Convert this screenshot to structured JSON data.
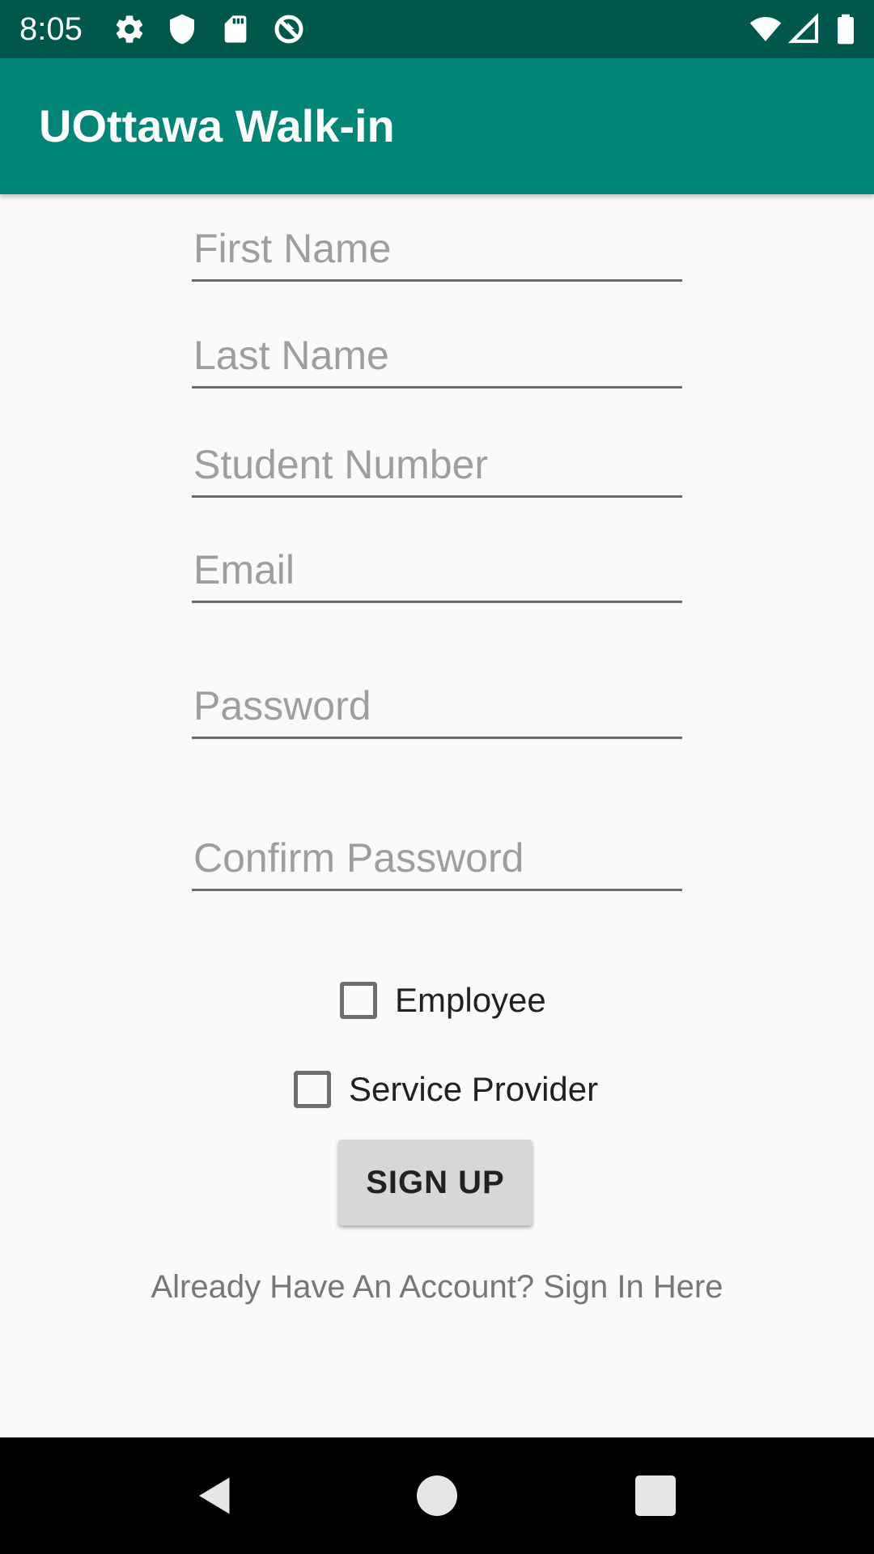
{
  "status_bar": {
    "time": "8:05",
    "left_icons": [
      "gear-icon",
      "shield-icon",
      "sd-card-icon",
      "no-sync-icon"
    ],
    "right_icons": [
      "wifi-icon",
      "signal-icon",
      "battery-icon"
    ],
    "background": "#00574b"
  },
  "app_bar": {
    "title": "UOttawa Walk-in",
    "background": "#008577"
  },
  "form": {
    "first_name": {
      "placeholder": "First Name",
      "value": ""
    },
    "last_name": {
      "placeholder": "Last Name",
      "value": ""
    },
    "student_number": {
      "placeholder": "Student Number",
      "value": ""
    },
    "email": {
      "placeholder": "Email",
      "value": ""
    },
    "password": {
      "placeholder": "Password",
      "value": ""
    },
    "confirm_password": {
      "placeholder": "Confirm Password",
      "value": ""
    }
  },
  "checkboxes": {
    "employee": {
      "label": "Employee",
      "checked": false
    },
    "service_provider": {
      "label": "Service Provider",
      "checked": false
    }
  },
  "signup_button": {
    "label": "SIGN UP"
  },
  "signin_link": {
    "text": "Already Have An Account? Sign In Here"
  },
  "nav_bar": {
    "buttons": [
      "back-icon",
      "home-icon",
      "recents-icon"
    ]
  }
}
